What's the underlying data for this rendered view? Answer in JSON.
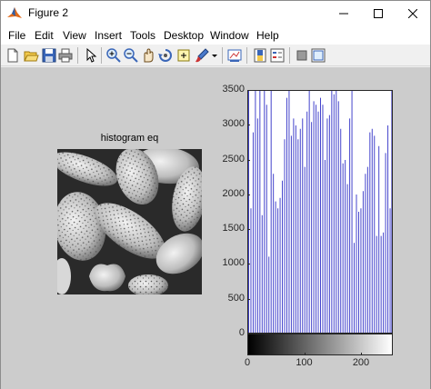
{
  "window": {
    "title": "Figure 2",
    "icon": "matlab-icon",
    "controls": [
      "minimize-icon",
      "maximize-icon",
      "close-icon"
    ]
  },
  "menu": [
    "File",
    "Edit",
    "View",
    "Insert",
    "Tools",
    "Desktop",
    "Window",
    "Help"
  ],
  "toolbar": [
    "new-figure-icon",
    "open-file-icon",
    "save-icon",
    "print-icon",
    "pointer-icon",
    "zoom-in-icon",
    "zoom-out-icon",
    "pan-icon",
    "rotate-3d-icon",
    "data-cursor-icon",
    "brush-icon",
    "dropdown-arrow-icon",
    "link-plot-icon",
    "colorbar-icon",
    "legend-icon",
    "hide-plot-tools-icon",
    "show-plot-tools-icon"
  ],
  "image_title": "histogram eq",
  "chart_data": {
    "type": "bar",
    "title": "",
    "xlabel": "",
    "ylabel": "",
    "xlim": [
      0,
      256
    ],
    "ylim": [
      0,
      3500
    ],
    "yticks": [
      "0",
      "500",
      "1000",
      "1500",
      "2000",
      "2500",
      "3000",
      "3500"
    ],
    "xticks": [
      "0",
      "100",
      "200"
    ],
    "bar_color": "#4444cc",
    "colorbar": "gray",
    "x": [
      0,
      4,
      8,
      12,
      16,
      20,
      24,
      28,
      32,
      36,
      40,
      44,
      48,
      52,
      56,
      60,
      64,
      68,
      72,
      76,
      80,
      84,
      88,
      92,
      96,
      100,
      104,
      108,
      112,
      116,
      120,
      124,
      128,
      132,
      136,
      140,
      144,
      148,
      152,
      156,
      160,
      164,
      168,
      172,
      176,
      180,
      184,
      188,
      192,
      196,
      200,
      204,
      208,
      212,
      216,
      220,
      224,
      228,
      232,
      236,
      240,
      244,
      248,
      252,
      255
    ],
    "values": [
      3500,
      1800,
      2900,
      3500,
      3100,
      3500,
      1700,
      3500,
      3300,
      1100,
      3500,
      2300,
      1900,
      1800,
      1950,
      2200,
      2800,
      3400,
      3600,
      2850,
      3100,
      3000,
      2800,
      2950,
      3100,
      2400,
      3200,
      3600,
      3050,
      3350,
      3300,
      3200,
      3400,
      3300,
      2500,
      3100,
      3150,
      3600,
      3450,
      3500,
      3350,
      2950,
      2450,
      2500,
      2150,
      3100,
      3600,
      1300,
      2000,
      1750,
      1800,
      2050,
      2300,
      2400,
      2900,
      2950,
      2850,
      1400,
      2700,
      1400,
      1450,
      2600,
      3000,
      1800,
      3500
    ]
  }
}
